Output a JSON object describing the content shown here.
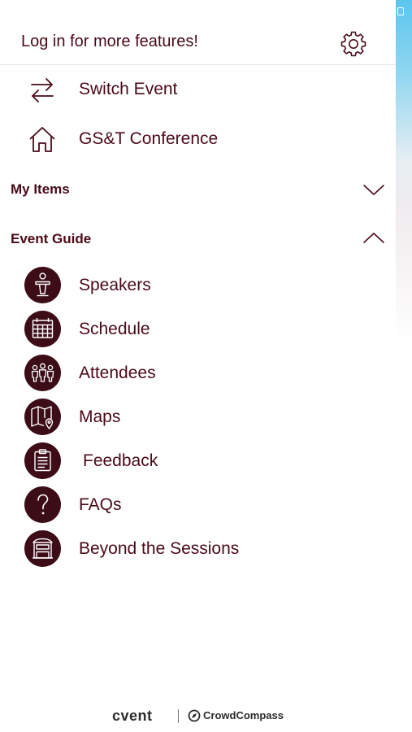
{
  "header": {
    "title": "Log in for more features!",
    "settings_icon": "gear-icon"
  },
  "nav": [
    {
      "label": "Switch Event",
      "icon": "swap-arrows-icon"
    },
    {
      "label": "GS&T Conference",
      "icon": "home-icon"
    }
  ],
  "sections": {
    "my_items": {
      "label": "My Items",
      "state": "collapsed"
    },
    "event_guide": {
      "label": "Event Guide",
      "state": "expanded"
    }
  },
  "event_guide_items": [
    {
      "label": "Speakers",
      "icon": "speaker-podium-icon"
    },
    {
      "label": "Schedule",
      "icon": "calendar-icon"
    },
    {
      "label": "Attendees",
      "icon": "people-icon"
    },
    {
      "label": "Maps",
      "icon": "map-icon"
    },
    {
      "label": "Feedback",
      "icon": "clipboard-icon"
    },
    {
      "label": "FAQs",
      "icon": "question-icon"
    },
    {
      "label": "Beyond the Sessions",
      "icon": "booth-icon"
    }
  ],
  "footer": {
    "brand": "cvent",
    "partner": "CrowdCompass"
  },
  "colors": {
    "accent": "#4a0a17",
    "icon_bg": "#3c0d17",
    "divider": "#e6e6e6",
    "edge_top": "#5cc6ee"
  }
}
